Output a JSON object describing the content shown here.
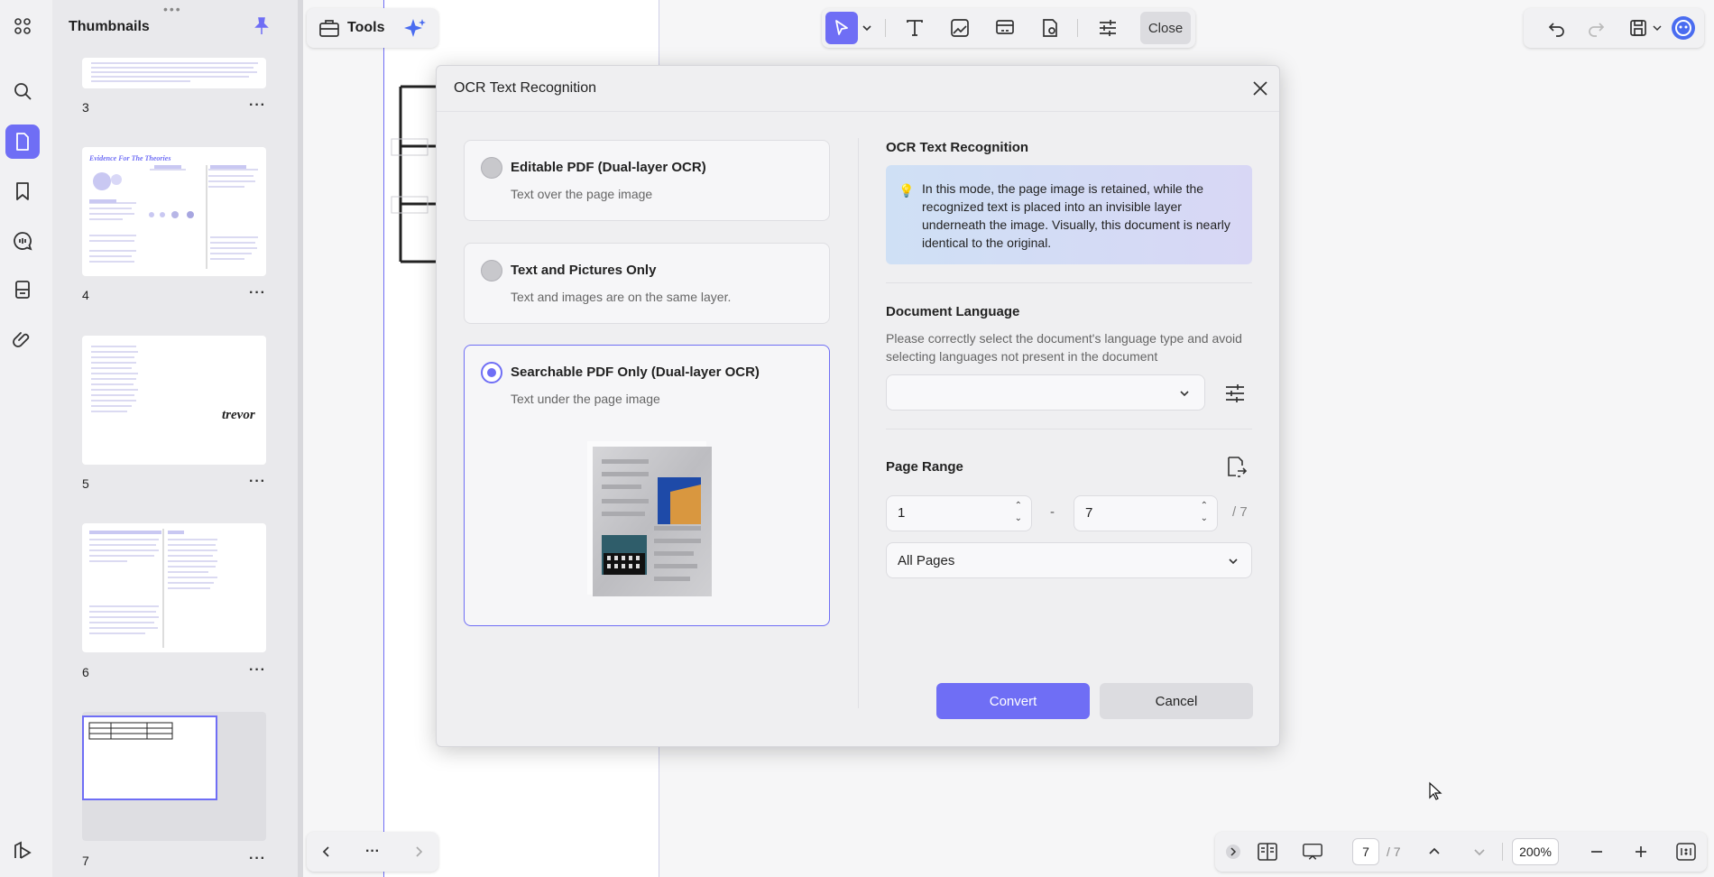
{
  "colors": {
    "accent": "#6f6ef5",
    "panel": "#e9e9ec",
    "dialog_bg": "#efeff1"
  },
  "left_rail": {
    "icons": [
      "grid-icon",
      "search-icon",
      "page-icon",
      "bookmark-icon",
      "comment-icon",
      "stamp-icon",
      "attachment-icon",
      "layers-icon"
    ]
  },
  "thumbnails": {
    "title": "Thumbnails",
    "pages": [
      {
        "number": "3"
      },
      {
        "number": "4",
        "heading": "Evidence For The Theories"
      },
      {
        "number": "5",
        "signature": "trevor"
      },
      {
        "number": "6"
      },
      {
        "number": "7"
      }
    ]
  },
  "toolbar": {
    "tools_label": "Tools",
    "close_label": "Close"
  },
  "bottom_bar": {
    "current_page": "7",
    "total_pages": "/ 7",
    "zoom": "200%"
  },
  "dialog": {
    "title": "OCR Text Recognition",
    "options": [
      {
        "title": "Editable PDF (Dual-layer OCR)",
        "description": "Text over the page image",
        "selected": false
      },
      {
        "title": "Text and Pictures Only",
        "description": "Text and images are on the same layer.",
        "selected": false
      },
      {
        "title": "Searchable PDF Only (Dual-layer OCR)",
        "description": "Text under the page image",
        "selected": true
      }
    ],
    "right": {
      "section_title": "OCR Text Recognition",
      "info_text": "In this mode, the page image is retained, while the recognized text is placed into an invisible layer underneath the image. Visually, this document is nearly identical to the original.",
      "language_title": "Document Language",
      "language_desc": "Please correctly select the document's language type and avoid selecting languages not present in the document",
      "language_value": "",
      "page_range_title": "Page Range",
      "range_from": "1",
      "range_dash": "-",
      "range_to": "7",
      "range_total": "/ 7",
      "range_mode": "All Pages"
    },
    "convert_label": "Convert",
    "cancel_label": "Cancel"
  }
}
